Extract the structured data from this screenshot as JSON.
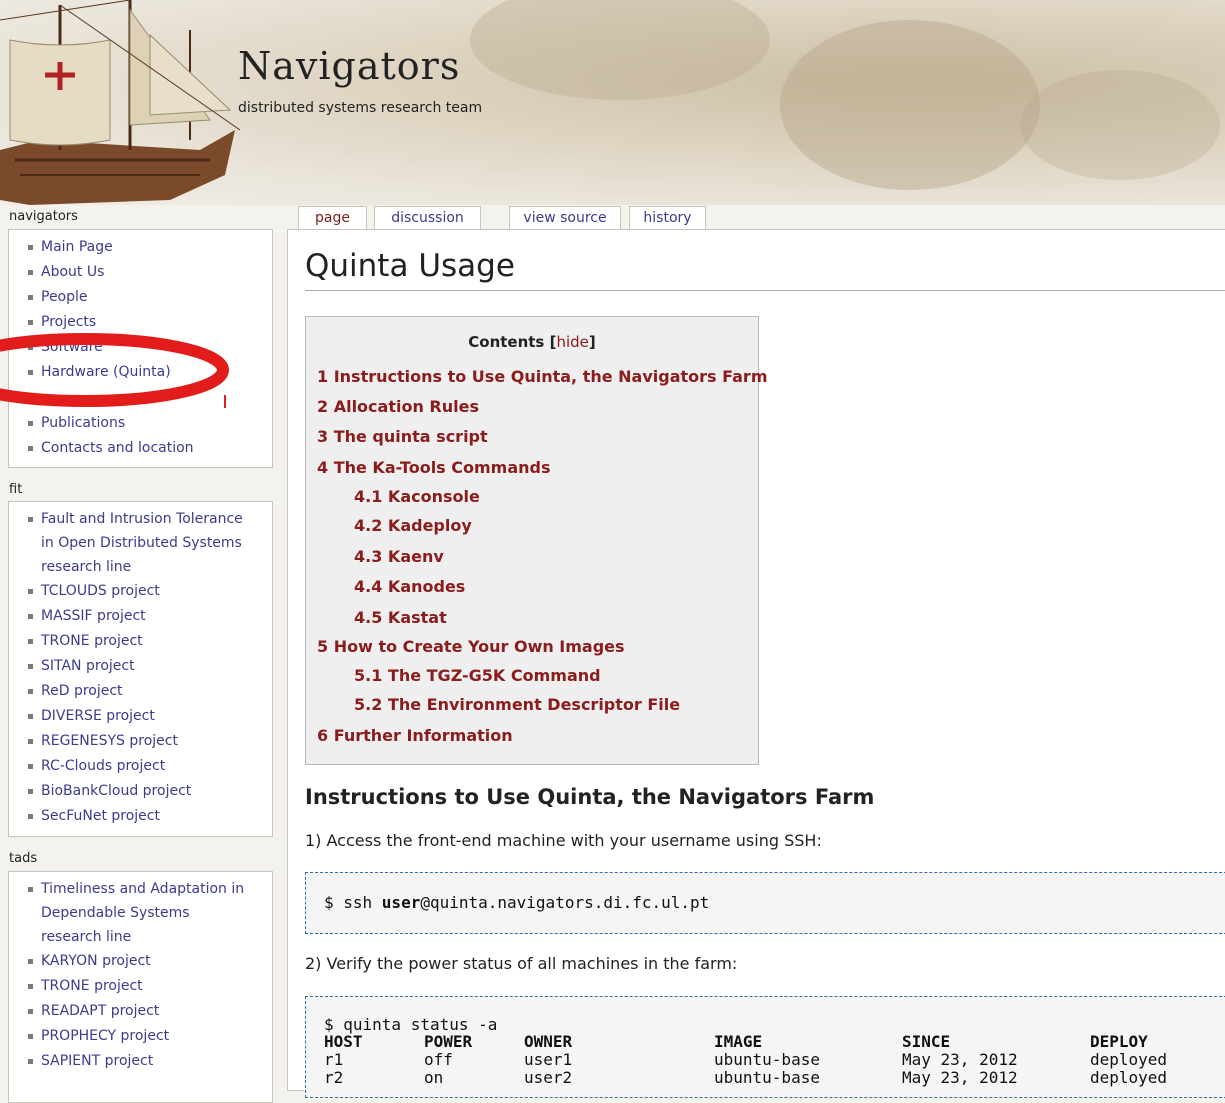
{
  "header": {
    "title": "Navigators",
    "subtitle": "distributed systems research team"
  },
  "sidebar": {
    "navigators": {
      "title": "navigators",
      "items": [
        "Main Page",
        "About Us",
        "People",
        "Projects",
        "Software",
        "Hardware (Quinta)",
        "Publications",
        "Contacts and location"
      ]
    },
    "fit": {
      "title": "fit",
      "items": [
        "Fault and Intrusion Tolerance in Open Distributed Systems research line",
        "TCLOUDS project",
        "MASSIF project",
        "TRONE project",
        "SITAN project",
        "ReD project",
        "DIVERSE project",
        "REGENESYS project",
        "RC-Clouds project",
        "BioBankCloud project",
        "SecFuNet project"
      ]
    },
    "tads": {
      "title": "tads",
      "items": [
        "Timeliness and Adaptation in Dependable Systems research line",
        "KARYON project",
        "TRONE project",
        "READAPT project",
        "PROPHECY project",
        "SAPIENT project"
      ]
    }
  },
  "tabs": [
    "page",
    "discussion",
    "view source",
    "history"
  ],
  "page": {
    "title": "Quinta Usage",
    "toc": {
      "title": "Contents",
      "hide_label": "hide",
      "entries": [
        "1 Instructions to Use Quinta, the Navigators Farm",
        "2 Allocation Rules",
        "3 The quinta script",
        "4 The Ka-Tools Commands",
        "4.1 Kaconsole",
        "4.2 Kadeploy",
        "4.3 Kaenv",
        "4.4 Kanodes",
        "4.5 Kastat",
        "5 How to Create Your Own Images",
        "5.1 The TGZ-G5K Command",
        "5.2 The Environment Descriptor File",
        "6 Further Information"
      ]
    },
    "section_heading": "Instructions to Use Quinta, the Navigators Farm",
    "step1": "1) Access the front-end machine with your username using SSH:",
    "ssh_cmd": {
      "prefix": "$ ssh ",
      "user": "user",
      "host": "@quinta.navigators.di.fc.ul.pt"
    },
    "step2": "2) Verify the power status of all machines in the farm:",
    "status_cmd": "$ quinta status -a",
    "status_table": {
      "headers": [
        "HOST",
        "POWER",
        "OWNER",
        "IMAGE",
        "SINCE",
        "DEPLOY"
      ],
      "rows": [
        [
          "r1",
          "off",
          "user1",
          "ubuntu-base",
          "May 23, 2012",
          "deployed"
        ],
        [
          "r2",
          "on",
          "user2",
          "ubuntu-base",
          "May 23, 2012",
          "deployed"
        ]
      ]
    }
  },
  "colors": {
    "link": "#3b3b8f",
    "toc_link": "#8b1c1c",
    "annotation": "#e21b1b"
  }
}
